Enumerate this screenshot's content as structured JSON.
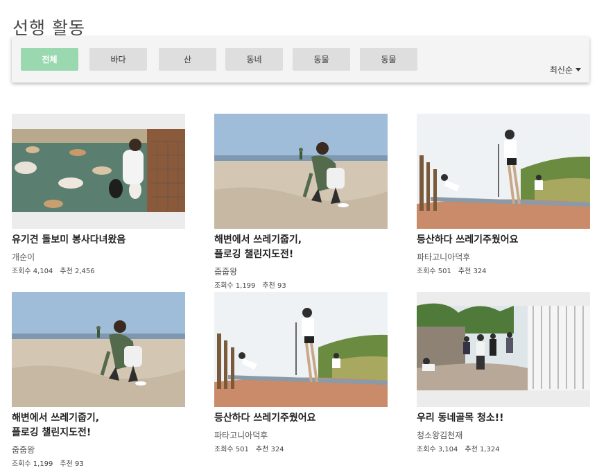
{
  "page": {
    "title": "선행 활동"
  },
  "filters": [
    {
      "label": "전체",
      "active": true
    },
    {
      "label": "바다",
      "active": false
    },
    {
      "label": "산",
      "active": false
    },
    {
      "label": "동네",
      "active": false
    },
    {
      "label": "동물",
      "active": false
    },
    {
      "label": "동물",
      "active": false
    }
  ],
  "sort": {
    "label": "최신순"
  },
  "cards": [
    {
      "title_line1": "유기견 돌보미 봉사다녀왔음",
      "title_line2": "",
      "author": "개순이",
      "views": "조회수 4,104",
      "likes": "추천 2,456",
      "image": "dogs-shelter-photo"
    },
    {
      "title_line1": "해변에서 쓰레기줍기,",
      "title_line2": "플로깅 챌린지도전!",
      "author": "줍줍왕",
      "views": "조회수 1,199",
      "likes": "추천 93",
      "image": "beach-plogging-photo"
    },
    {
      "title_line1": "등산하다 쓰레기주웠어요",
      "title_line2": "",
      "author": "파타고니아덕후",
      "views": "조회수 501",
      "likes": "추천 324",
      "image": "hiking-path-photo"
    },
    {
      "title_line1": "해변에서 쓰레기줍기,",
      "title_line2": "플로깅 챌린지도전!",
      "author": "줍줍왕",
      "views": "조회수 1,199",
      "likes": "추천 93",
      "image": "beach-plogging-photo"
    },
    {
      "title_line1": "등산하다 쓰레기주웠어요",
      "title_line2": "",
      "author": "파타고니아덕후",
      "views": "조회수 501",
      "likes": "추천 324",
      "image": "hiking-path-photo"
    },
    {
      "title_line1": "우리 동네골목 청소!!",
      "title_line2": "",
      "author": "청소왕김천재",
      "views": "조회수 3,104",
      "likes": "추천 1,324",
      "image": "alley-cleanup-photo"
    }
  ],
  "colors": {
    "active_chip": "#9ad8b0",
    "chip": "#dedede",
    "panel": "#f4f4f4"
  }
}
